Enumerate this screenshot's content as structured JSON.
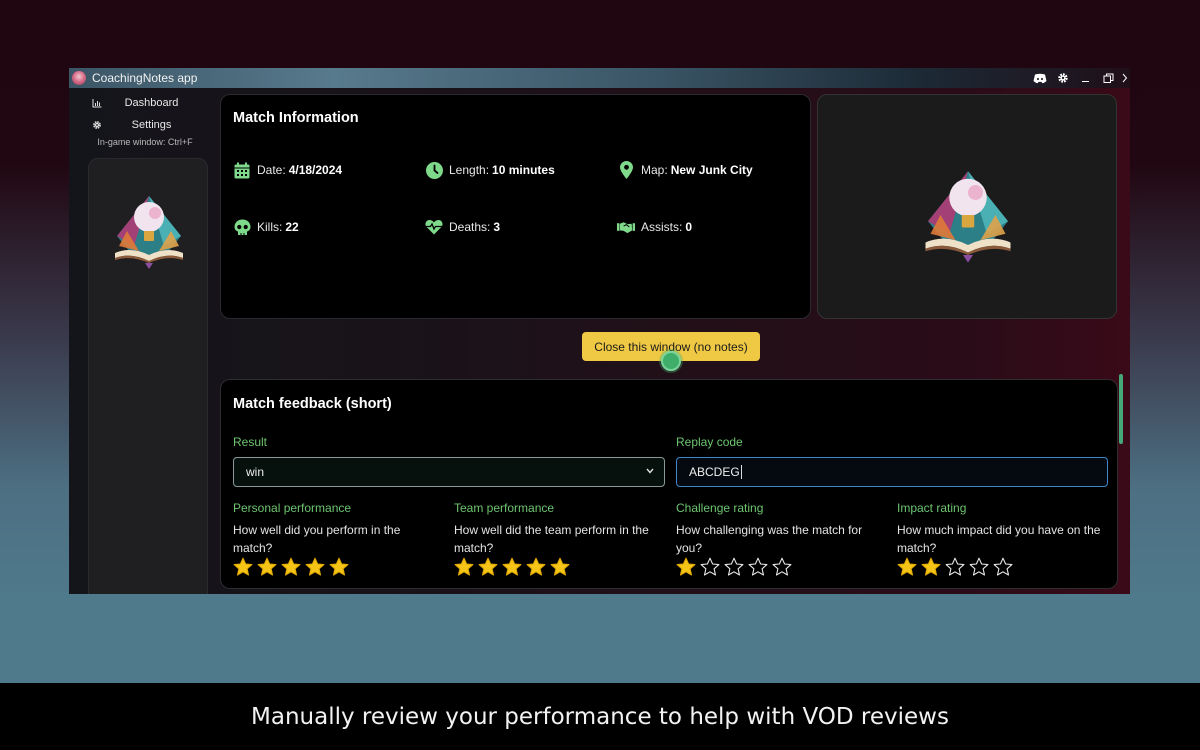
{
  "window": {
    "title": "CoachingNotes app",
    "title_actions": [
      {
        "icon": "discord-icon"
      },
      {
        "icon": "gear-icon"
      },
      {
        "icon": "minimize-icon"
      },
      {
        "icon": "restore-icon"
      },
      {
        "icon": "chevron-right-icon"
      }
    ]
  },
  "sidebar": {
    "items": [
      {
        "label": "Dashboard",
        "icon": "chart-icon"
      },
      {
        "label": "Settings",
        "icon": "gear-icon"
      }
    ],
    "hint": "In-game window: Ctrl+F"
  },
  "match_info": {
    "title": "Match Information",
    "stats": [
      {
        "label": "Date:",
        "value": "4/18/2024",
        "icon": "calendar-icon"
      },
      {
        "label": "Length:",
        "value": "10 minutes",
        "icon": "clock-icon"
      },
      {
        "label": "Map:",
        "value": "New Junk City",
        "icon": "map-pin-icon"
      },
      {
        "label": "Kills:",
        "value": "22",
        "icon": "skull-icon"
      },
      {
        "label": "Deaths:",
        "value": "3",
        "icon": "heartbeat-icon"
      },
      {
        "label": "Assists:",
        "value": "0",
        "icon": "handshake-icon"
      }
    ]
  },
  "close_button": {
    "label": "Close this window (no notes)"
  },
  "feedback": {
    "title": "Match feedback (short)",
    "result": {
      "label": "Result",
      "value": "win"
    },
    "replay": {
      "label": "Replay code",
      "value": "ABCDEG"
    },
    "ratings": [
      {
        "title": "Personal performance",
        "question": "How well did you perform in the match?",
        "value": 5,
        "max": 5
      },
      {
        "title": "Team performance",
        "question": "How well did the team perform in the match?",
        "value": 5,
        "max": 5
      },
      {
        "title": "Challenge rating",
        "question": "How challenging was the match for you?",
        "value": 1,
        "max": 5
      },
      {
        "title": "Impact rating",
        "question": "How much impact did you have on the match?",
        "value": 2,
        "max": 5
      }
    ]
  },
  "colors": {
    "accent_green": "#6cc56f",
    "star_gold": "#f5c518",
    "button_yellow": "#f0c944",
    "input_focus": "#3f87c9"
  },
  "caption": "Manually review your performance to help with VOD reviews"
}
